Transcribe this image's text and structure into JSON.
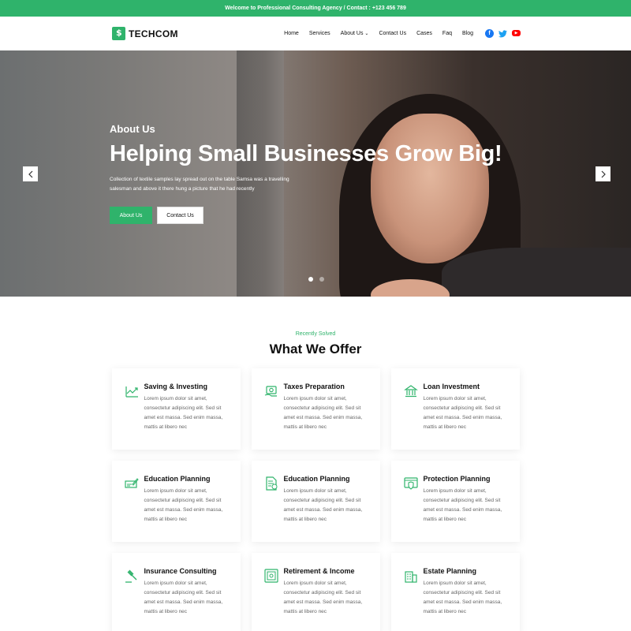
{
  "topbar": {
    "text": "Welcome to Professional Consulting Agency / Contact : +123 456 789"
  },
  "header": {
    "logo_text": "TECHCOM",
    "nav": [
      {
        "label": "Home"
      },
      {
        "label": "Services"
      },
      {
        "label": "About Us",
        "has_dropdown": true
      },
      {
        "label": "Contact Us"
      },
      {
        "label": "Cases"
      },
      {
        "label": "Faq"
      },
      {
        "label": "Blog"
      }
    ],
    "social": [
      "facebook-icon",
      "twitter-icon",
      "youtube-icon"
    ]
  },
  "hero": {
    "subtitle": "About Us",
    "title": "Helping Small Businesses Grow Big!",
    "description": "Collection of textile samples lay spread out on the table Samsa was a travelling salesman and above it there hung a picture that he had recently",
    "primary_button": "About Us",
    "secondary_button": "Contact Us",
    "active_slide": 1,
    "slide_count": 2
  },
  "offer": {
    "kicker": "Recently Solved",
    "title": "What We Offer",
    "cards": [
      {
        "title": "Saving & Investing",
        "icon": "chart-icon",
        "text": "Lorem ipsum dolor sit amet, consectetur adipiscing elit. Sed sit amet est massa. Sed enim massa, mattis at libero nec"
      },
      {
        "title": "Taxes Preparation",
        "icon": "money-icon",
        "text": "Lorem ipsum dolor sit amet, consectetur adipiscing elit. Sed sit amet est massa. Sed enim massa, mattis at libero nec"
      },
      {
        "title": "Loan Investment",
        "icon": "bank-icon",
        "text": "Lorem ipsum dolor sit amet, consectetur adipiscing elit. Sed sit amet est massa. Sed enim massa, mattis at libero nec"
      },
      {
        "title": "Education Planning",
        "icon": "cheque-icon",
        "text": "Lorem ipsum dolor sit amet, consectetur adipiscing elit. Sed sit amet est massa. Sed enim massa, mattis at libero nec"
      },
      {
        "title": "Education Planning",
        "icon": "document-icon",
        "text": "Lorem ipsum dolor sit amet, consectetur adipiscing elit. Sed sit amet est massa. Sed enim massa, mattis at libero nec"
      },
      {
        "title": "Protection Planning",
        "icon": "shield-screen-icon",
        "text": "Lorem ipsum dolor sit amet, consectetur adipiscing elit. Sed sit amet est massa. Sed enim massa, mattis at libero nec"
      },
      {
        "title": "Insurance Consulting",
        "icon": "gavel-icon",
        "text": "Lorem ipsum dolor sit amet, consectetur adipiscing elit. Sed sit amet est massa. Sed enim massa, mattis at libero nec"
      },
      {
        "title": "Retirement & Income",
        "icon": "safe-icon",
        "text": "Lorem ipsum dolor sit amet, consectetur adipiscing elit. Sed sit amet est massa. Sed enim massa, mattis at libero nec"
      },
      {
        "title": "Estate Planning",
        "icon": "building-icon",
        "text": "Lorem ipsum dolor sit amet, consectetur adipiscing elit. Sed sit amet est massa. Sed enim massa, mattis at libero nec"
      }
    ]
  },
  "colors": {
    "accent": "#2fb36b",
    "facebook": "#1877f2",
    "twitter": "#1da1f2",
    "youtube": "#ff0000"
  }
}
